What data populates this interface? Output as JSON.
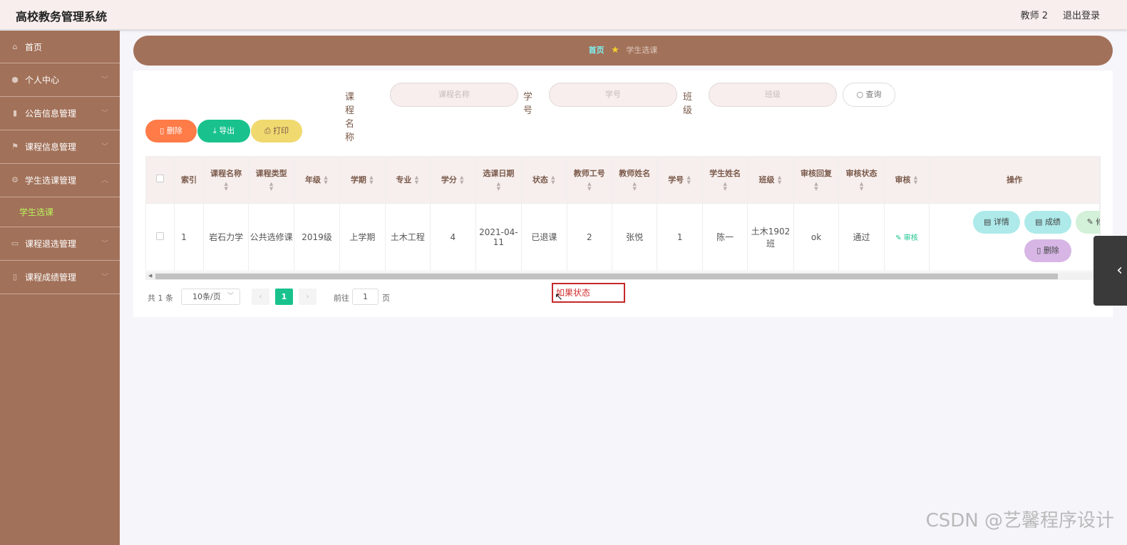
{
  "header": {
    "title": "高校教务管理系统",
    "user": "教师 2",
    "logout": "退出登录"
  },
  "sidebar": {
    "items": [
      {
        "label": "首页",
        "icon": "home-icon"
      },
      {
        "label": "个人中心",
        "icon": "user-icon"
      },
      {
        "label": "公告信息管理",
        "icon": "chart-icon"
      },
      {
        "label": "课程信息管理",
        "icon": "flag-icon"
      },
      {
        "label": "学生选课管理",
        "icon": "gear-icon"
      },
      {
        "label": "课程退选管理",
        "icon": "chat-icon"
      },
      {
        "label": "课程成绩管理",
        "icon": "phone-icon"
      }
    ],
    "sub_active": "学生选课"
  },
  "breadcrumb": {
    "home": "首页",
    "current": "学生选课"
  },
  "search": {
    "course_label": "课程名称",
    "course_placeholder": "课程名称",
    "sid_label": "学号",
    "sid_placeholder": "学号",
    "class_label": "班级",
    "class_placeholder": "班级",
    "query": "查询"
  },
  "actions": {
    "delete": "删除",
    "export": "导出",
    "print": "打印"
  },
  "table": {
    "columns": [
      "索引",
      "课程名称",
      "课程类型",
      "年级",
      "学期",
      "专业",
      "学分",
      "选课日期",
      "状态",
      "教师工号",
      "教师姓名",
      "学号",
      "学生姓名",
      "班级",
      "审核回复",
      "审核状态",
      "审核",
      "操作"
    ],
    "rows": [
      {
        "index": "1",
        "course": "岩石力学",
        "type": "公共选修课",
        "grade": "2019级",
        "term": "上学期",
        "major": "土木工程",
        "credit": "4",
        "date": "2021-04-11",
        "status": "已退课",
        "tid": "2",
        "tname": "张悦",
        "sid": "1",
        "sname": "陈一",
        "class": "土木1902班",
        "reply": "ok",
        "audit_status": "通过",
        "audit": "审核",
        "ops": {
          "detail": "详情",
          "grade": "成绩",
          "edit": "修改",
          "delete": "删除"
        }
      }
    ]
  },
  "pagination": {
    "total": "共 1 条",
    "page_size": "10条/页",
    "current": "1",
    "goto": "前往",
    "goto_value": "1",
    "page_suffix": "页"
  },
  "annotation": {
    "text": "如果状态"
  },
  "watermark": "CSDN @艺馨程序设计"
}
